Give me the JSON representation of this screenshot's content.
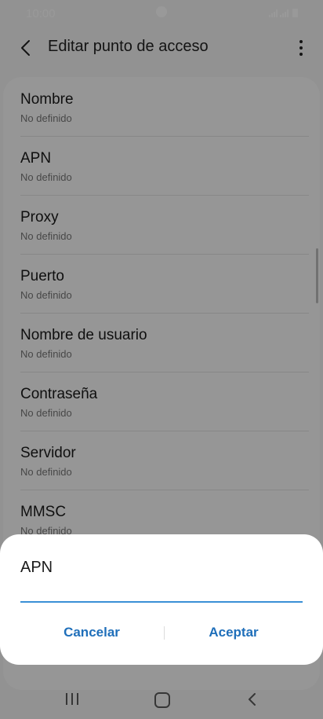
{
  "status_bar": {
    "time": "10:00",
    "icons": [
      "signal-icon",
      "signal-icon",
      "battery-icon"
    ]
  },
  "header": {
    "title": "Editar punto de acceso",
    "back_icon": "chevron-left-icon",
    "more_icon": "more-vertical-icon"
  },
  "settings": [
    {
      "label": "Nombre",
      "value": "No definido"
    },
    {
      "label": "APN",
      "value": "No definido"
    },
    {
      "label": "Proxy",
      "value": "No definido"
    },
    {
      "label": "Puerto",
      "value": "No definido"
    },
    {
      "label": "Nombre de usuario",
      "value": "No definido"
    },
    {
      "label": "Contraseña",
      "value": "No definido"
    },
    {
      "label": "Servidor",
      "value": "No definido"
    },
    {
      "label": "MMSC",
      "value": "No definido"
    }
  ],
  "dialog": {
    "title": "APN",
    "input_value": "",
    "cancel_label": "Cancelar",
    "accept_label": "Aceptar"
  },
  "nav_bar": {
    "icons": [
      "recent-apps-icon",
      "home-icon",
      "back-icon"
    ]
  },
  "colors": {
    "accent": "#1f6fba",
    "input_underline": "#3a8fd6",
    "background": "#f4f4f4",
    "card": "#fbfbfb"
  }
}
